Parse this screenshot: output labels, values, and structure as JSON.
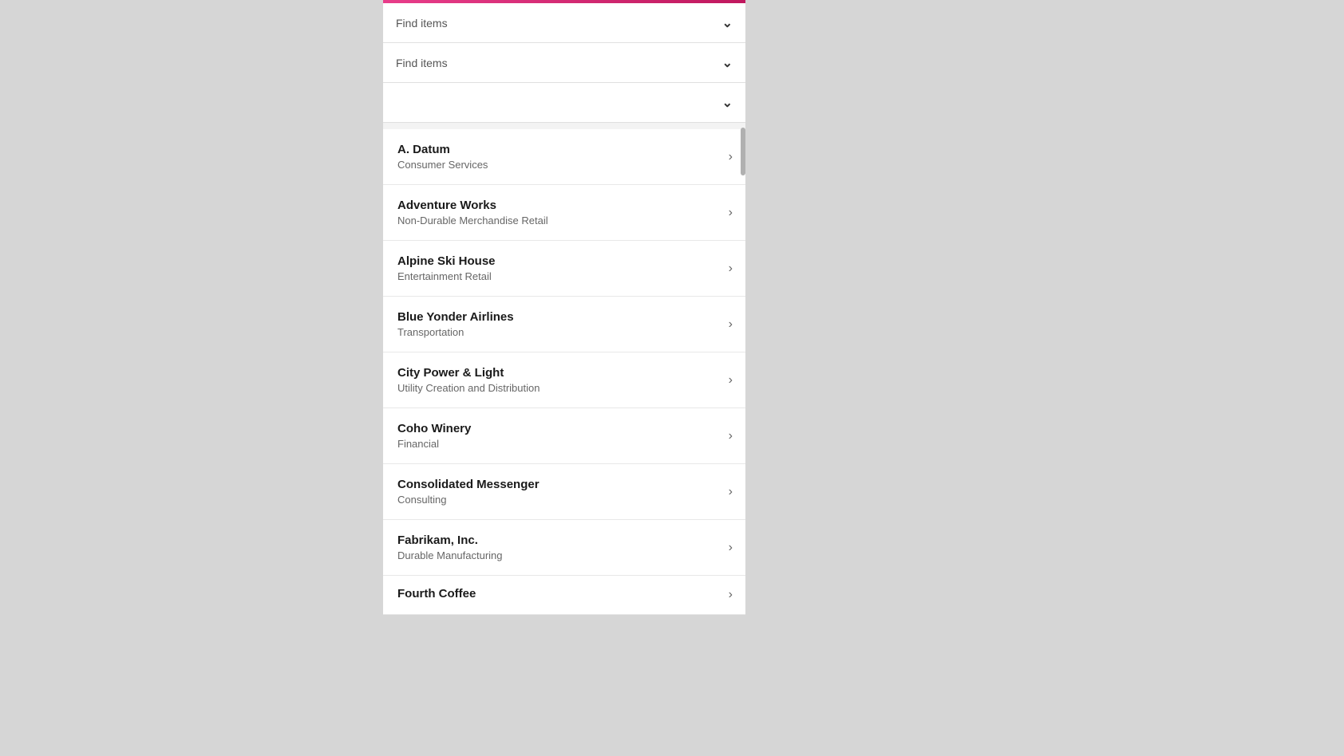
{
  "topBar": {
    "color": "#e83d8a"
  },
  "filters": [
    {
      "id": "filter1",
      "placeholder": "Find items",
      "hasValue": false
    },
    {
      "id": "filter2",
      "placeholder": "Find items",
      "hasValue": false
    },
    {
      "id": "filter3",
      "placeholder": "",
      "hasValue": false
    }
  ],
  "chevronSymbol": "⌄",
  "chevronRightSymbol": "›",
  "items": [
    {
      "id": "a-datum",
      "name": "A. Datum",
      "subtitle": "Consumer Services"
    },
    {
      "id": "adventure-works",
      "name": "Adventure Works",
      "subtitle": "Non-Durable Merchandise Retail"
    },
    {
      "id": "alpine-ski-house",
      "name": "Alpine Ski House",
      "subtitle": "Entertainment Retail"
    },
    {
      "id": "blue-yonder-airlines",
      "name": "Blue Yonder Airlines",
      "subtitle": "Transportation"
    },
    {
      "id": "city-power-light",
      "name": "City Power & Light",
      "subtitle": "Utility Creation and Distribution"
    },
    {
      "id": "coho-winery",
      "name": "Coho Winery",
      "subtitle": "Financial"
    },
    {
      "id": "consolidated-messenger",
      "name": "Consolidated Messenger",
      "subtitle": "Consulting"
    },
    {
      "id": "fabrikam-inc",
      "name": "Fabrikam, Inc.",
      "subtitle": "Durable Manufacturing"
    },
    {
      "id": "fourth-coffee",
      "name": "Fourth Coffee",
      "subtitle": ""
    }
  ]
}
